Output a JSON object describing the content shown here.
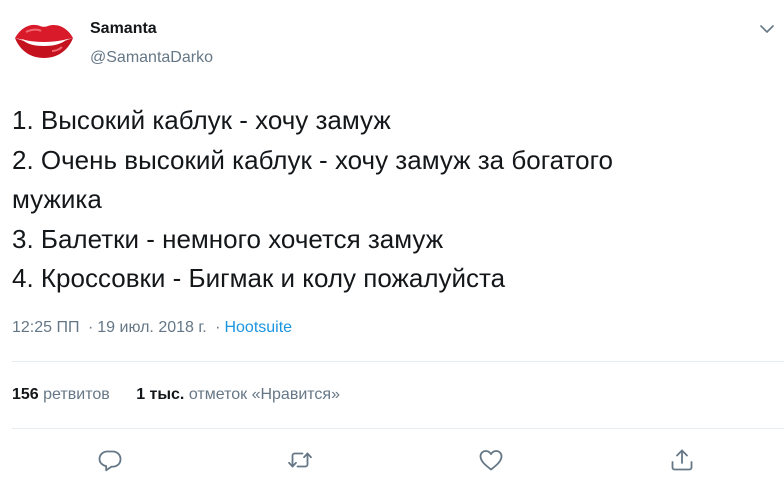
{
  "author": {
    "name": "Samanta",
    "handle": "@SamantaDarko",
    "avatar_icon": "red-lips-icon"
  },
  "menu": {
    "icon": "chevron-down-icon"
  },
  "body_lines": [
    "1. Высокий каблук - хочу замуж",
    "2. Очень высокий каблук - хочу замуж за богатого",
    "мужика",
    "3. Балетки - немного хочется замуж",
    "4. Кроссовки - Бигмак и колу пожалуйста"
  ],
  "meta": {
    "time": "12:25 ПП",
    "separator": "·",
    "date": "19 июл. 2018 г.",
    "source": "Hootsuite"
  },
  "stats": {
    "retweets_count": "156",
    "retweets_label": "ретвитов",
    "likes_count": "1 тыс.",
    "likes_label": "отметок «Нравится»"
  },
  "actions": {
    "reply_icon": "reply-icon",
    "retweet_icon": "retweet-icon",
    "like_icon": "heart-icon",
    "share_icon": "share-icon"
  },
  "colors": {
    "text": "#14171a",
    "muted": "#657786",
    "link": "#1b95e0",
    "divider": "#e6ecf0",
    "lips": "#d91a2a"
  }
}
